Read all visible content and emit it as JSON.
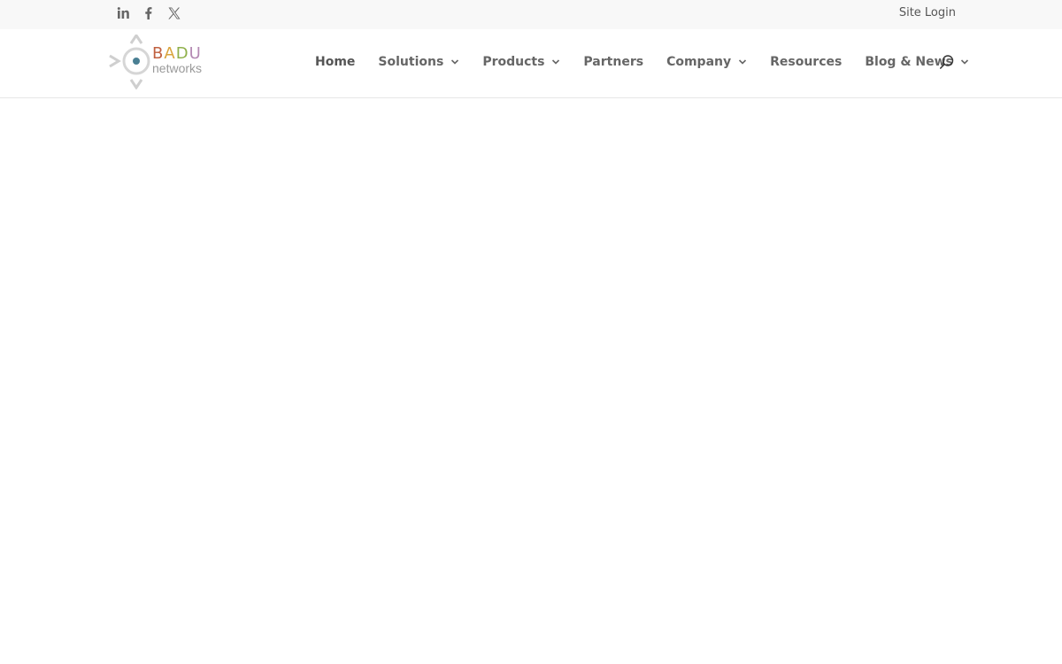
{
  "top_bar": {
    "social_icons": [
      "linkedin-icon",
      "facebook-icon",
      "x-icon"
    ],
    "site_login_label": "Site Login"
  },
  "logo": {
    "brand_letters": [
      "B",
      "A",
      "D",
      "U"
    ],
    "brand_colors": [
      "#c0603f",
      "#d9a43c",
      "#8fb04a",
      "#b48ab3"
    ],
    "sub_text": "networks"
  },
  "nav": {
    "items": [
      {
        "label": "Home",
        "has_dropdown": false,
        "active": true
      },
      {
        "label": "Solutions",
        "has_dropdown": true,
        "active": false
      },
      {
        "label": "Products",
        "has_dropdown": true,
        "active": false
      },
      {
        "label": "Partners",
        "has_dropdown": false,
        "active": false
      },
      {
        "label": "Company",
        "has_dropdown": true,
        "active": false
      },
      {
        "label": "Resources",
        "has_dropdown": false,
        "active": false
      },
      {
        "label": "Blog & News",
        "has_dropdown": true,
        "active": false
      }
    ],
    "search_icon": "search-icon"
  },
  "colors": {
    "top_bar_bg": "#f8f8f8",
    "nav_text": "#666666",
    "logo_dot": "#4a7f93"
  }
}
